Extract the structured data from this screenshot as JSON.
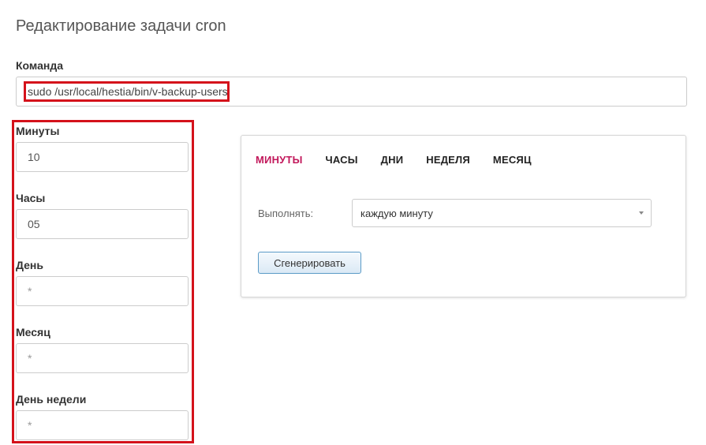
{
  "page": {
    "title": "Редактирование задачи cron"
  },
  "command": {
    "label": "Команда",
    "value": "sudo /usr/local/hestia/bin/v-backup-users"
  },
  "fields": [
    {
      "label": "Минуты",
      "value": "10"
    },
    {
      "label": "Часы",
      "value": "05"
    },
    {
      "label": "День",
      "value": "*"
    },
    {
      "label": "Месяц",
      "value": "*"
    },
    {
      "label": "День недели",
      "value": "*"
    }
  ],
  "generator": {
    "tabs": [
      {
        "label": "МИНУТЫ",
        "active": true
      },
      {
        "label": "ЧАСЫ",
        "active": false
      },
      {
        "label": "ДНИ",
        "active": false
      },
      {
        "label": "НЕДЕЛЯ",
        "active": false
      },
      {
        "label": "МЕСЯЦ",
        "active": false
      }
    ],
    "run_label": "Выполнять:",
    "run_selected": "каждую минуту",
    "generate_button": "Сгенерировать"
  },
  "colors": {
    "active_tab": "#c2185b",
    "highlight": "#d4121b",
    "button_border": "#5b9bc7"
  },
  "icons": {
    "select_arrow": "caret-down-icon"
  }
}
